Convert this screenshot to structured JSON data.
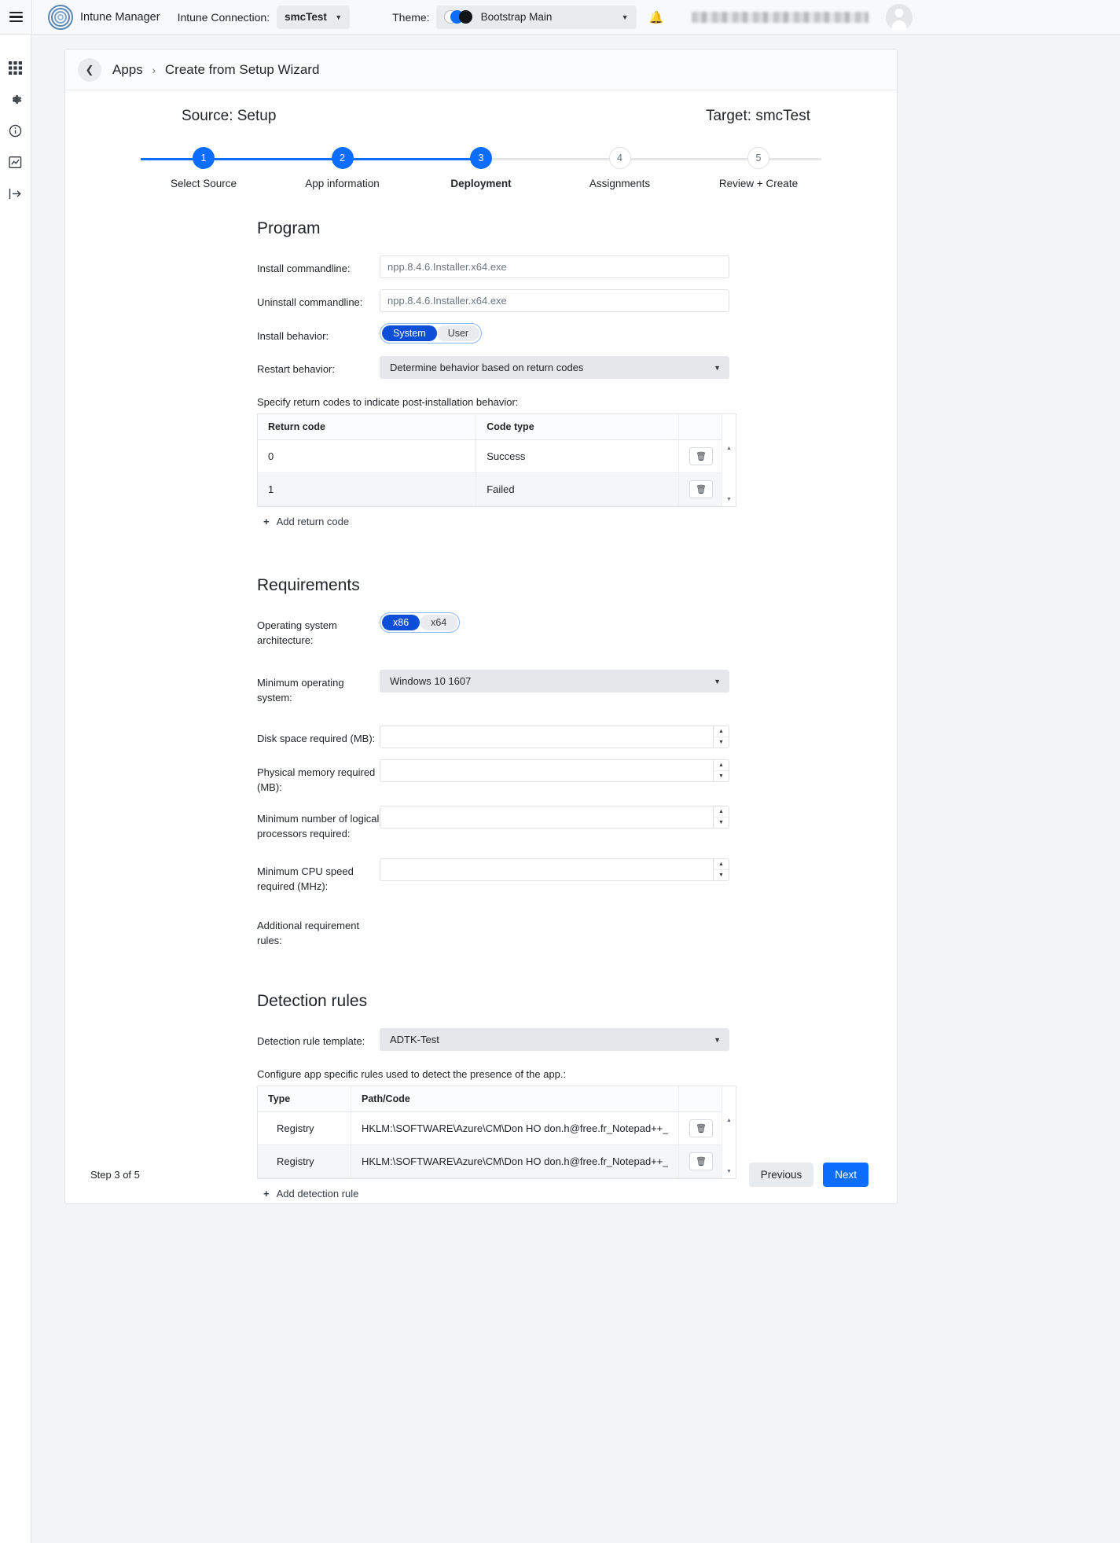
{
  "topbar": {
    "menu_icon": "hamburger-icon",
    "brand": "Intune Manager",
    "connection_label": "Intune Connection:",
    "connection_value": "smcTest",
    "theme_label": "Theme:",
    "theme_value": "Bootstrap Main",
    "bell_icon": "bell-icon",
    "avatar_icon": "user-avatar-icon"
  },
  "rail": {
    "items": [
      {
        "icon": "grid-apps-icon"
      },
      {
        "icon": "gear-settings-icon"
      },
      {
        "icon": "info-circle-icon"
      },
      {
        "icon": "chart-reports-icon"
      },
      {
        "icon": "sign-out-icon"
      }
    ]
  },
  "breadcrumb": {
    "back_icon": "chevron-left-icon",
    "parent": "Apps",
    "separator": "›",
    "current": "Create from Setup Wizard"
  },
  "context": {
    "source": "Source: Setup",
    "target": "Target:  smcTest"
  },
  "stepper": {
    "steps": [
      {
        "number": "1",
        "label": "Select Source",
        "state": "done"
      },
      {
        "number": "2",
        "label": "App information",
        "state": "done"
      },
      {
        "number": "3",
        "label": "Deployment",
        "state": "current"
      },
      {
        "number": "4",
        "label": "Assignments",
        "state": "todo"
      },
      {
        "number": "5",
        "label": "Review + Create",
        "state": "todo"
      }
    ]
  },
  "program": {
    "title": "Program",
    "install_cmd_label": "Install commandline:",
    "install_cmd_value": "npp.8.4.6.Installer.x64.exe",
    "uninstall_cmd_label": "Uninstall commandline:",
    "uninstall_cmd_value": "npp.8.4.6.Installer.x64.exe",
    "install_behavior_label": "Install behavior:",
    "install_behavior_options": [
      "System",
      "User"
    ],
    "install_behavior_selected": "System",
    "restart_behavior_label": "Restart behavior:",
    "restart_behavior_value": "Determine behavior based on return codes",
    "return_codes_note": "Specify return codes to indicate post-installation behavior:",
    "return_codes_columns": [
      "Return code",
      "Code type"
    ],
    "return_codes_rows": [
      {
        "code": "0",
        "type": "Success",
        "delete_icon": "trash-icon"
      },
      {
        "code": "1",
        "type": "Failed",
        "delete_icon": "trash-icon"
      }
    ],
    "add_return_code": "Add return code"
  },
  "requirements": {
    "title": "Requirements",
    "os_arch_label": "Operating system architecture:",
    "os_arch_options": [
      "x86",
      "x64"
    ],
    "os_arch_selected": "x86",
    "min_os_label": "Minimum operating system:",
    "min_os_value": "Windows 10 1607",
    "disk_space_label": "Disk space required (MB):",
    "disk_space_value": "",
    "memory_label": "Physical memory required (MB):",
    "memory_value": "",
    "processors_label": "Minimum number of logical processors required:",
    "processors_value": "",
    "cpu_speed_label": "Minimum CPU speed required (MHz):",
    "cpu_speed_value": "",
    "additional_rules_label": "Additional requirement rules:"
  },
  "detection": {
    "title": "Detection rules",
    "template_label": "Detection rule template:",
    "template_value": "ADTK-Test",
    "note": "Configure app specific rules used to detect the presence of the app.:",
    "columns": [
      "Type",
      "Path/Code"
    ],
    "rows": [
      {
        "type": "Registry",
        "path": "HKLM:\\SOFTWARE\\Azure\\CM\\Don HO don.h@free.fr_Notepad++_x",
        "delete_icon": "trash-icon"
      },
      {
        "type": "Registry",
        "path": "HKLM:\\SOFTWARE\\Azure\\CM\\Don HO don.h@free.fr_Notepad++_x",
        "delete_icon": "trash-icon"
      }
    ],
    "add_rule": "Add detection rule"
  },
  "footer": {
    "step_count": "Step 3 of 5",
    "previous": "Previous",
    "next": "Next"
  },
  "colors": {
    "accent": "#0d6efd",
    "accent_dark": "#0d4fd6",
    "page_bg": "#f3f4f6",
    "field_bg": "#e5e7ea"
  }
}
